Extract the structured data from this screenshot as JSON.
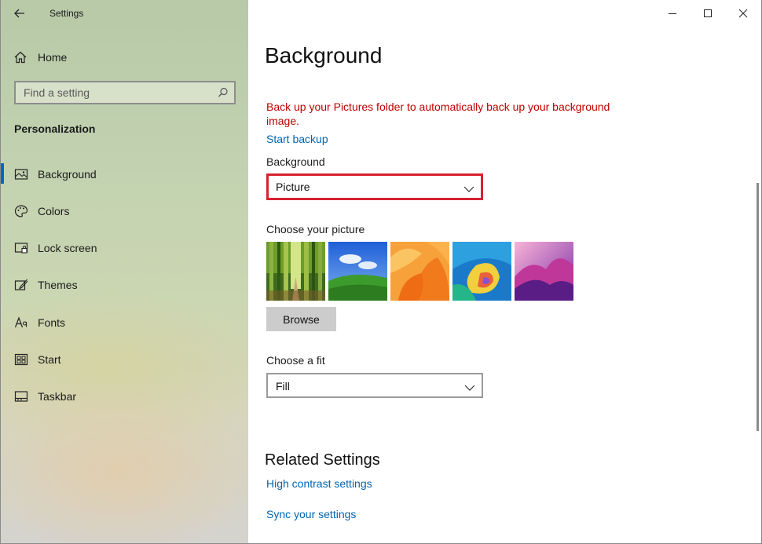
{
  "app": {
    "title": "Settings"
  },
  "sidebar": {
    "home_label": "Home",
    "search_placeholder": "Find a setting",
    "section_title": "Personalization",
    "items": [
      {
        "label": "Background",
        "icon": "picture-icon",
        "selected": true
      },
      {
        "label": "Colors",
        "icon": "palette-icon",
        "selected": false
      },
      {
        "label": "Lock screen",
        "icon": "lock-screen-icon",
        "selected": false
      },
      {
        "label": "Themes",
        "icon": "themes-brush-icon",
        "selected": false
      },
      {
        "label": "Fonts",
        "icon": "fonts-icon",
        "selected": false
      },
      {
        "label": "Start",
        "icon": "start-icon",
        "selected": false
      },
      {
        "label": "Taskbar",
        "icon": "taskbar-icon",
        "selected": false
      }
    ]
  },
  "main": {
    "title": "Background",
    "backup_warning": "Back up your Pictures folder to automatically back up your background image.",
    "backup_link": "Start backup",
    "background_label": "Background",
    "background_value": "Picture",
    "choose_picture_label": "Choose your picture",
    "browse_label": "Browse",
    "fit_label": "Choose a fit",
    "fit_value": "Fill",
    "related_title": "Related Settings",
    "related_links": [
      "High contrast settings",
      "Sync your settings"
    ]
  },
  "colors": {
    "accent": "#0067c0",
    "warning": "#c00000",
    "link": "#0063b1",
    "highlight_box": "#d7212f"
  },
  "thumbnails": [
    "bamboo-forest",
    "green-hills-blue-sky",
    "orange-abstract-petals",
    "blue-colorful-swirl",
    "pink-purple-mountains"
  ]
}
